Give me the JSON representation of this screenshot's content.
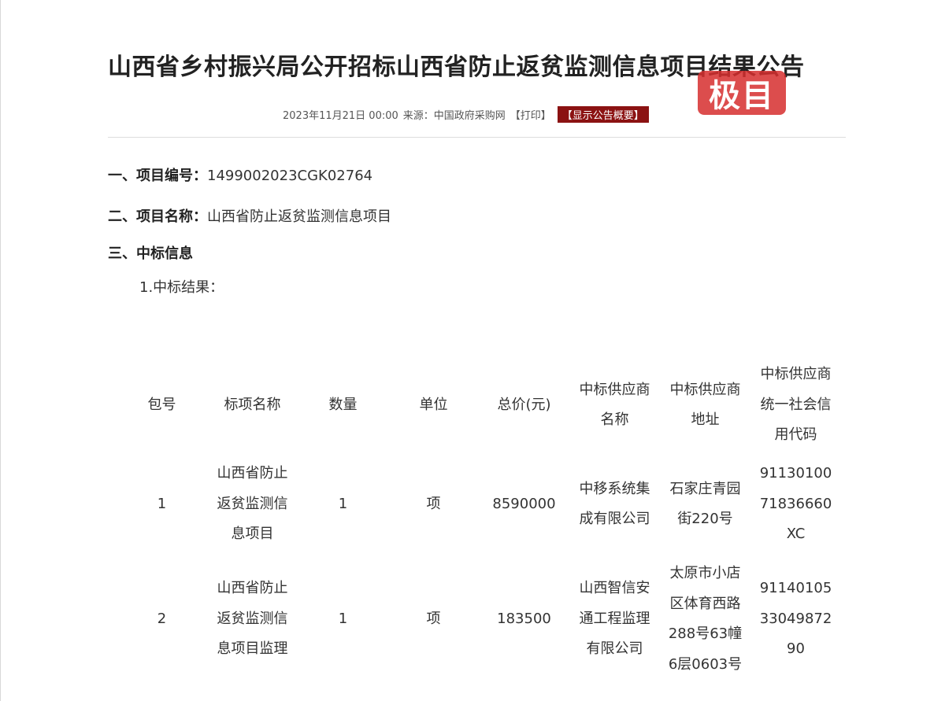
{
  "title": "山西省乡村振兴局公开招标山西省防止返贫监测信息项目结果公告",
  "logo_text": "极目",
  "meta": {
    "datetime": "2023年11月21日 00:00",
    "source": "来源：中国政府采购网",
    "print": "【打印】",
    "summary": "【显示公告概要】"
  },
  "fields": {
    "project_no_label": "一、项目编号：",
    "project_no": "1499002023CGK02764",
    "project_name_label": "二、项目名称：",
    "project_name": "山西省防止返贫监测信息项目",
    "award_info_label": "三、中标信息",
    "award_result_label": "1.中标结果："
  },
  "table": {
    "headers": [
      "包号",
      "标项名称",
      "数量",
      "单位",
      "总价(元)",
      "中标供应商名称",
      "中标供应商地址",
      "中标供应商统一社会信用代码"
    ],
    "rows": [
      [
        "1",
        "山西省防止返贫监测信息项目",
        "1",
        "项",
        "8590000",
        "中移系统集成有限公司",
        "石家庄青园街220号",
        "9113010071836660XC"
      ],
      [
        "2",
        "山西省防止返贫监测信息项目监理",
        "1",
        "项",
        "183500",
        "山西智信安通工程监理有限公司",
        "太原市小店区体育西路288号63幢6层0603号",
        "911401053304987290"
      ]
    ]
  },
  "colors": {
    "summary_bg": "#8b1212",
    "logo_bg": "#d62e2e"
  }
}
